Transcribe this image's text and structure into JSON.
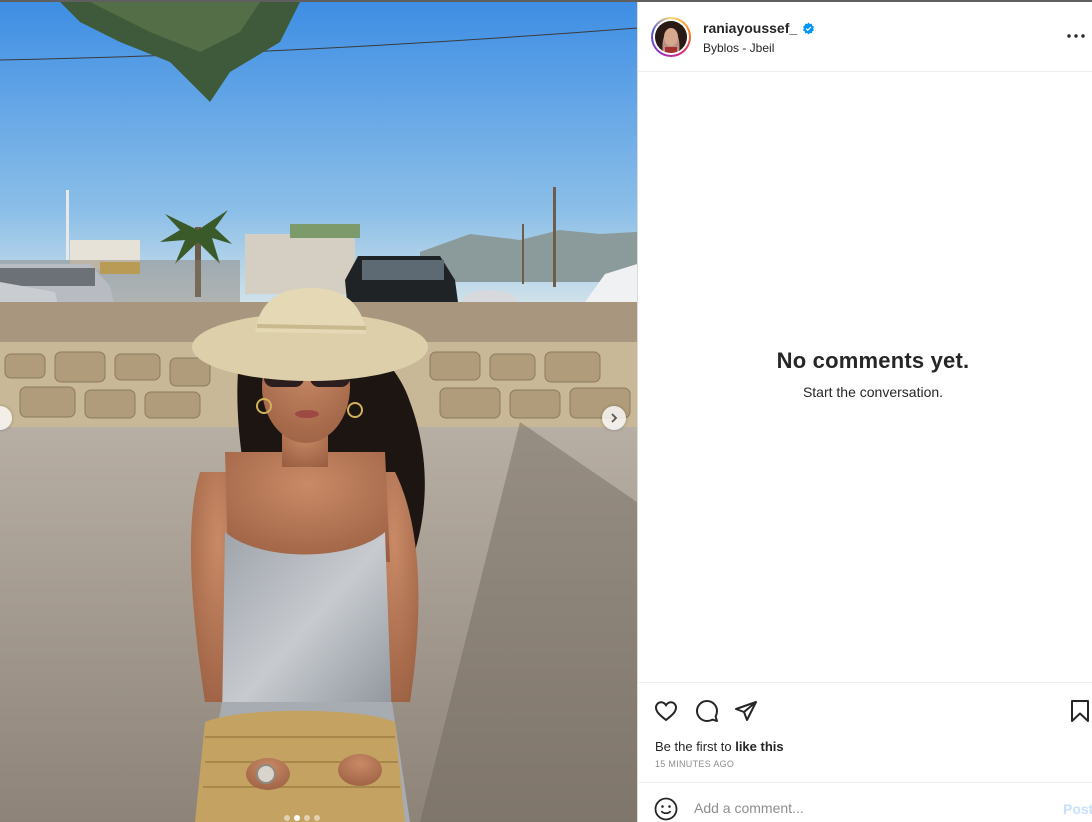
{
  "post": {
    "username": "raniayoussef_",
    "verified": true,
    "location": "Byblos - Jbeil",
    "carousel": {
      "slide_count": 4,
      "active_index": 1
    }
  },
  "comments": {
    "empty_title": "No comments yet.",
    "empty_subtitle": "Start the conversation."
  },
  "likes": {
    "prefix": "Be the first to ",
    "action": "like this"
  },
  "timestamp": "15 MINUTES AGO",
  "comment_bar": {
    "placeholder": "Add a comment...",
    "post_label": "Post"
  },
  "icons": [
    "heart-icon",
    "comment-icon",
    "share-icon",
    "bookmark-icon",
    "more-icon",
    "emoji-icon",
    "chevron-right-icon",
    "verified-badge-icon"
  ],
  "colors": {
    "verified_blue": "#0095f6",
    "post_button_disabled": "#c7e0fd",
    "muted_text": "#8e8e8e",
    "divider": "#efefef"
  }
}
